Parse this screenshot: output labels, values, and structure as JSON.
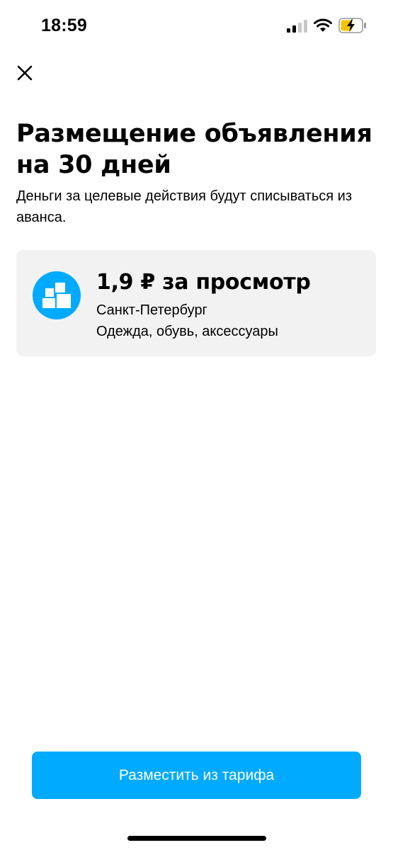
{
  "status_bar": {
    "time": "18:59",
    "icons": [
      "signal-icon",
      "wifi-icon",
      "battery-charging-icon"
    ]
  },
  "header": {
    "close_icon": "close-icon"
  },
  "main": {
    "title": "Размещение объявления на 30 дней",
    "subtitle": "Деньги за целевые действия будут списываться из аванса."
  },
  "tariff": {
    "icon": "blocks-icon",
    "price": "1,9 ₽ за просмотр",
    "city": "Санкт-Петербург",
    "category": "Одежда, обувь, аксессуары"
  },
  "footer": {
    "submit_label": "Разместить из тарифа"
  },
  "colors": {
    "accent": "#00aaff",
    "card_background": "#f2f2f2",
    "battery_charge": "#f5c400"
  }
}
